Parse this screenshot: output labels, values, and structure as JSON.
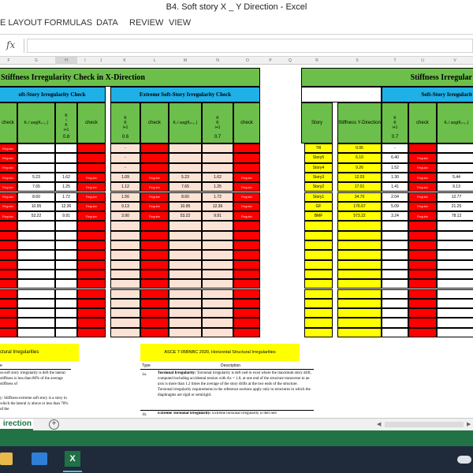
{
  "window": {
    "title": "B4. Soft story X _ Y Direction - Excel"
  },
  "ribbon": {
    "tabs": [
      "E LAYOUT",
      "FORMULAS",
      "DATA",
      "REVIEW",
      "VIEW"
    ]
  },
  "formula_bar": {
    "fx": "fx",
    "value": ""
  },
  "columns": [
    "F",
    "G",
    "H",
    "I",
    "J",
    "K",
    "L",
    "M",
    "N",
    "O",
    "P",
    "Q",
    "R",
    "S",
    "T",
    "U",
    "V",
    "W"
  ],
  "x_section": {
    "title": "Stiffness Irregularity Check in X-Direction",
    "soft_title": "oft-Story Irregularity Check",
    "extreme_title": "Extreme Soft-Story Irregularity Check",
    "h_check": "check",
    "h_k_ratio_num": "K",
    "h_k_ratio_sub": "i",
    "h_k_ratio_den": "K",
    "h_k_ratio_den_sub": "i+1",
    "h_avg": "Kᵢ / avg(Kᵢ₊₁..)",
    "limit_soft": "0.8",
    "limit_extreme_a": "0.6",
    "limit_extreme_b": "0.7",
    "label": "Regular",
    "rows": [
      {
        "c1": "",
        "c2": "",
        "e1": "-",
        "e2": "",
        "e3": ""
      },
      {
        "c1": "",
        "c2": "",
        "e1": "-",
        "e2": "",
        "e3": ""
      },
      {
        "c1": "",
        "c2": "",
        "e1": "-",
        "e2": "",
        "e3": ""
      },
      {
        "c1": "5.23",
        "c2": "1.62",
        "e1": "1.09",
        "e2": "5.23",
        "e3": "1.62"
      },
      {
        "c1": "7.65",
        "c2": "1.25",
        "e1": "1.12",
        "e2": "7.65",
        "e3": "1.25"
      },
      {
        "c1": "8.60",
        "c2": "1.72",
        "e1": "1.56",
        "e2": "8.60",
        "e3": "1.72"
      },
      {
        "c1": "10.95",
        "c2": "12.36",
        "e1": "9.13",
        "e2": "10.95",
        "e3": "12.36"
      },
      {
        "c1": "53.22",
        "c2": "9.91",
        "e1": "3.90",
        "e2": "53.22",
        "e3": "9.91"
      }
    ]
  },
  "y_section": {
    "title": "Stiffness Irregular",
    "soft_title": "Soft-Story Irregularit",
    "h_story": "Story",
    "h_stiffness": "Stiffness Y-Direction",
    "h_check": "check",
    "limit": "0.7",
    "label": "Regular",
    "rows": [
      {
        "story": "TR",
        "stiff": "0.95",
        "ratio": "-",
        "avg": ""
      },
      {
        "story": "Story5",
        "stiff": "6.10",
        "ratio": "6.40",
        "avg": ""
      },
      {
        "story": "Story4",
        "stiff": "9.26",
        "ratio": "1.52",
        "avg": ""
      },
      {
        "story": "Story3",
        "stiff": "12.03",
        "ratio": "1.30",
        "avg": "5.44"
      },
      {
        "story": "Story2",
        "stiff": "17.01",
        "ratio": "1.41",
        "avg": "9.13"
      },
      {
        "story": "Story1",
        "stiff": "34.70",
        "ratio": "2.04",
        "avg": "12.77"
      },
      {
        "story": "GF",
        "stiff": "176.67",
        "ratio": "5.09",
        "avg": "21.25"
      },
      {
        "story": "BMF",
        "stiff": "573.22",
        "ratio": "3.24",
        "avg": "78.12"
      }
    ]
  },
  "notes": {
    "left_banner": "ctural Irregularities",
    "left_type": "e",
    "left_text1": "ss-soft story irregularity is defi the lateral stiffness is less than 80% of the average stiffness of",
    "left_text2": "y: Stiffness-extreme soft story is a story in which the lateral ry above or less than 70% of the",
    "right_banner": "ASCE 7-05BNBC 2020, Horizontal Structural Irregularities",
    "col_type": "Type",
    "col_desc": "Description",
    "row1_type": "1a.",
    "row1_title": "Torsional Irregularity:",
    "row1_text": "Torsional irregularity is defi ned to exist where the maximum story drift, computed including accidental torsion with Ax = 1.0, at one end of the structure transverse to an axis is more than 1.2 times the average of the story drifts at the two ends of the structure. Torsional irregularity requirements in the reference sections apply only to structures in which the diaphragms are rigid or semirigid.",
    "row2_type": "1b.",
    "row2_title": "Extreme Torsional Irregularity:",
    "row2_text": "Extreme torsional irregularity is defi ned"
  },
  "sheet_tab": {
    "label": "irection"
  },
  "colors": {
    "green": "#6dbf4b",
    "blue": "#1fb0e8",
    "red": "#ff0000",
    "yellow": "#ffff00",
    "pink": "#fbe2d5",
    "excel": "#217346"
  }
}
